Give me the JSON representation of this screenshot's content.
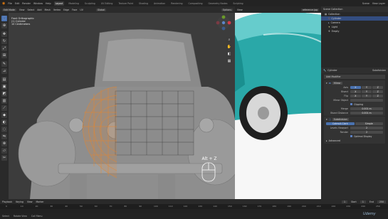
{
  "topbar": {
    "menus": [
      "File",
      "Edit",
      "Render",
      "Window",
      "Help"
    ],
    "tabs": [
      "Layout",
      "Modeling",
      "Sculpting",
      "UV Editing",
      "Texture Paint",
      "Shading",
      "Animation",
      "Rendering",
      "Compositing",
      "Geometry Nodes",
      "Scripting"
    ],
    "active_tab": "Layout",
    "scene": "Scene",
    "view_layer": "View Layer"
  },
  "viewport": {
    "mode": "Edit Mode",
    "menus": [
      "View",
      "Select",
      "Add",
      "Mesh",
      "Vertex",
      "Edge",
      "Face",
      "UV"
    ],
    "transform": "Global",
    "options": "Options",
    "overlay_lines": [
      "Front Orthographic",
      "(1) Cylinder",
      "10 Centimeters"
    ],
    "key_hint": "Alt + Z"
  },
  "image_editor": {
    "label": "View",
    "image_name": "reference.jpg"
  },
  "outliner": {
    "title": "Scene Collection",
    "items": [
      {
        "label": "Collection",
        "indent": 1
      },
      {
        "label": "Cylinder",
        "indent": 2,
        "selected": true
      },
      {
        "label": "Camera",
        "indent": 2
      },
      {
        "label": "Light",
        "indent": 2
      },
      {
        "label": "Empty",
        "indent": 2
      }
    ]
  },
  "properties": {
    "object": "Cylinder",
    "modifier": "Subdivision",
    "add_modifier": "Add Modifier",
    "mirror": {
      "name": "Mirror",
      "axis_label": "Axis",
      "axes": [
        "X",
        "Y",
        "Z"
      ],
      "bisect_label": "Bisect",
      "flip_label": "Flip",
      "mirror_object_label": "Mirror Object",
      "clipping": "Clipping",
      "merge_label": "Merge",
      "merge_value": "0.001 m",
      "bisect_distance_label": "Bisect Distance",
      "bisect_distance": "0.001 m"
    },
    "subdivision": {
      "name": "Subdivision",
      "modes": [
        "Catmull-Clark",
        "Simple"
      ],
      "levels_viewport_label": "Levels Viewport",
      "levels_viewport": "2",
      "render_label": "Render",
      "render": "2",
      "optimal_display": "Optimal Display",
      "advanced": "Advanced"
    }
  },
  "timeline": {
    "menus": [
      "Playback",
      "Keying",
      "View",
      "Marker"
    ],
    "start_label": "Start",
    "start": "1",
    "end_label": "End",
    "end": "250",
    "current": "1",
    "ticks": [
      "0",
      "10",
      "20",
      "30",
      "40",
      "50",
      "60",
      "70",
      "80",
      "90",
      "100",
      "110",
      "120",
      "130",
      "140",
      "150",
      "160",
      "170",
      "180",
      "190",
      "200",
      "210",
      "220",
      "230",
      "240",
      "250"
    ]
  },
  "status": {
    "items": [
      "Select",
      "Rotate View",
      "Call Menu"
    ]
  },
  "watermark": "Udemy",
  "colors": {
    "accent": "#4a72b0",
    "wire": "#e8862a",
    "car_teal": "#2aa8a8"
  }
}
